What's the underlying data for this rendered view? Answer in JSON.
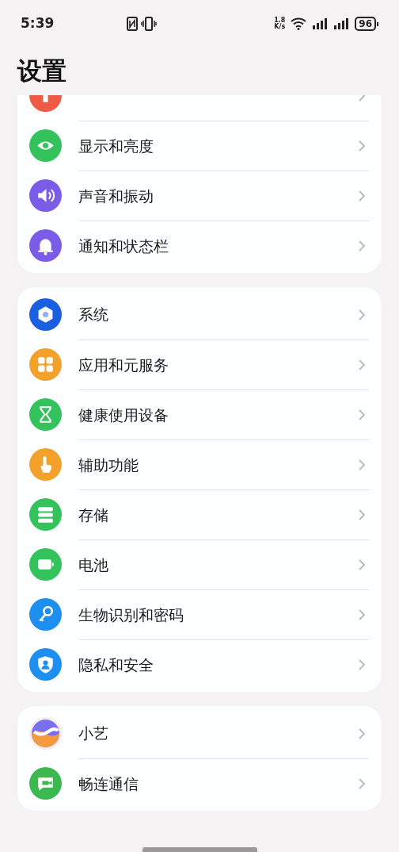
{
  "status_bar": {
    "time": "5:39",
    "net_speed_value": "1.8",
    "net_speed_unit": "K/s",
    "battery": "96"
  },
  "title": "设置",
  "groups": [
    {
      "items": [
        {
          "kind": "desktop"
        },
        {
          "kind": "display",
          "label": "显示和亮度"
        },
        {
          "kind": "sound",
          "label": "声音和振动"
        },
        {
          "kind": "notification",
          "label": "通知和状态栏"
        }
      ]
    },
    {
      "items": [
        {
          "kind": "system",
          "label": "系统"
        },
        {
          "kind": "apps",
          "label": "应用和元服务"
        },
        {
          "kind": "health",
          "label": "健康使用设备"
        },
        {
          "kind": "accessibility",
          "label": "辅助功能"
        },
        {
          "kind": "storage",
          "label": "存储"
        },
        {
          "kind": "battery",
          "label": "电池"
        },
        {
          "kind": "biometric",
          "label": "生物识别和密码"
        },
        {
          "kind": "privacy",
          "label": "隐私和安全"
        }
      ]
    },
    {
      "items": [
        {
          "kind": "assistant",
          "label": "小艺"
        },
        {
          "kind": "messaging",
          "label": "畅连通信"
        }
      ]
    }
  ]
}
